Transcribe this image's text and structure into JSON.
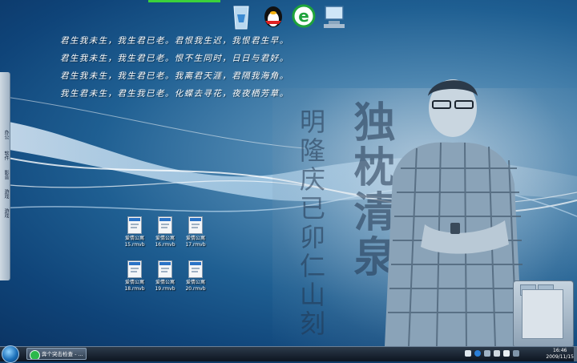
{
  "poem": {
    "lines": [
      "君生我未生，我生君已老。君恨我生迟，我恨君生早。",
      "君生我未生，我生君已老。恨不生同时，日日与君好。",
      "君生我未生，我生君已老。我离君天涯，君隔我海角。",
      "我生君未生，君生我已老。化蝶去寻花，夜夜栖芳草。"
    ]
  },
  "calligraphy": {
    "large": "独枕清泉",
    "small": "明隆庆已卯仁山刻"
  },
  "sidebar": {
    "items": [
      "办公",
      "软件",
      "影音",
      "游戏",
      "游戏"
    ]
  },
  "files": [
    {
      "name": "爱情公寓",
      "ext": "15.rmvb"
    },
    {
      "name": "爱情公寓",
      "ext": "16.rmvb"
    },
    {
      "name": "爱情公寓",
      "ext": "17.rmvb"
    },
    {
      "name": "爱情公寓",
      "ext": "18.rmvb"
    },
    {
      "name": "爱情公寓",
      "ext": "19.rmvb"
    },
    {
      "name": "爱情公寓",
      "ext": "20.rmvb"
    }
  ],
  "top_icons": [
    "recycle-bin-icon",
    "qq-penguin-icon",
    "ie-browser-icon",
    "network-computer-icon"
  ],
  "taskbar": {
    "task_label": "奔个突击检查 - ...",
    "clock_time": "16:46",
    "clock_date": "2009/11/15"
  },
  "colors": {
    "accent_green": "#3bd13b",
    "taskbar": "#1a2533",
    "desktop": "#1f5f92"
  }
}
